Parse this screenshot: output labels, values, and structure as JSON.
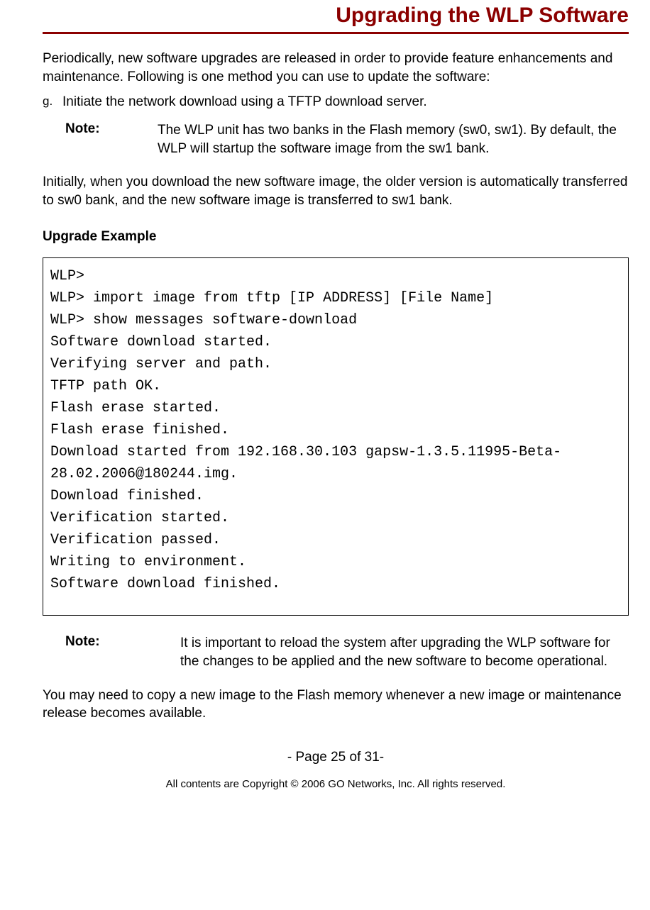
{
  "title": "Upgrading the WLP Software",
  "intro": "Periodically, new software upgrades are released in order to provide feature enhancements and maintenance. Following is one method you can use to update the software:",
  "list": {
    "marker": "g.",
    "item": "Initiate the network download using a TFTP download server."
  },
  "note1": {
    "label": "Note:",
    "text": "The WLP unit has two banks in the Flash memory (sw0, sw1). By default, the WLP will startup the software image from the sw1 bank."
  },
  "para2": "Initially, when you download the new software image, the older version is automatically transferred to sw0 bank, and the new software image is transferred to sw1 bank.",
  "example_heading": "Upgrade Example",
  "code": {
    "l0": "WLP>",
    "l1": "WLP> import image from tftp [IP ADDRESS] [File Name]",
    "l2": "WLP> show messages software-download",
    "l3": "Software download started.",
    "l4": "Verifying server and path.",
    "l5": "TFTP path OK.",
    "l6": "Flash erase started.",
    "l7": "Flash erase finished.",
    "l8": "Download started from 192.168.30.103 gapsw-1.3.5.11995-Beta-28.02.2006@180244.img.",
    "l9": "Download finished.",
    "l10": "Verification started.",
    "l11": "Verification passed.",
    "l12": "Writing to environment.",
    "l13": "Software download finished."
  },
  "note2": {
    "label": "Note:",
    "text": "It is important to reload the system after upgrading the WLP software for the changes to be applied and the new software to become operational."
  },
  "para3": "You may need to copy a new image to the Flash memory whenever a new image or maintenance release becomes available.",
  "footer": {
    "page": "- Page 25 of 31-",
    "copyright": "All contents are Copyright © 2006 GO Networks, Inc. All rights reserved."
  }
}
